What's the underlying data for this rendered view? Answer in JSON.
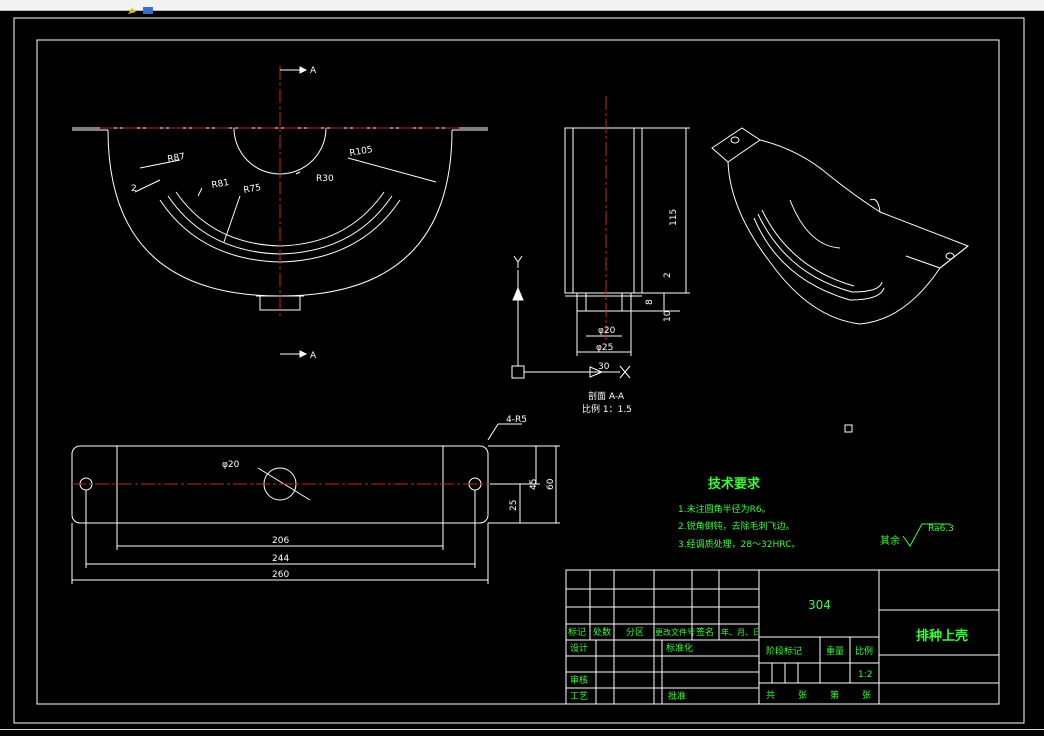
{
  "drawing": {
    "section_mark": "A",
    "dims_front": {
      "r87": "R87",
      "r30": "R30",
      "r105": "R105",
      "r81": "R81",
      "r75": "R75",
      "d2": "2"
    },
    "dims_section": {
      "h115": "115",
      "d2": "2",
      "d8": "8",
      "d10": "10",
      "phi20": "φ20",
      "phi25": "φ25",
      "w30": "30"
    },
    "section_caption": "剖面 A-A",
    "scale_caption": "比例 1：1.5",
    "axis_y": "Y",
    "axis_x": "X",
    "dims_bottom": {
      "holes": "4-R5",
      "phi20": "φ20",
      "l206": "206",
      "l244": "244",
      "l260": "260",
      "h25": "25",
      "h45": "45",
      "h60": "60"
    },
    "tech": {
      "title": "技术要求",
      "items": [
        "1.未注圆角半径为R6。",
        "2.锐角倒钝，去除毛刺飞边。",
        "3.经调质处理，28～32HRC。"
      ]
    },
    "roughness": {
      "label": "其余",
      "value": "Ra6.3"
    },
    "title_block": {
      "material": "304",
      "part_name": "排种上壳",
      "row_labels": [
        "标记",
        "处数",
        "分区",
        "更改文件号",
        "签名",
        "年、月、日"
      ],
      "design": "设计",
      "standard": "标准化",
      "review": "审核",
      "process": "工艺",
      "approve": "批准",
      "stage_mark": "阶段标记",
      "weight": "重量",
      "ratio": "比例",
      "ratio_value": "1:2",
      "sheets": [
        "共",
        "张",
        "第",
        "张"
      ]
    }
  }
}
